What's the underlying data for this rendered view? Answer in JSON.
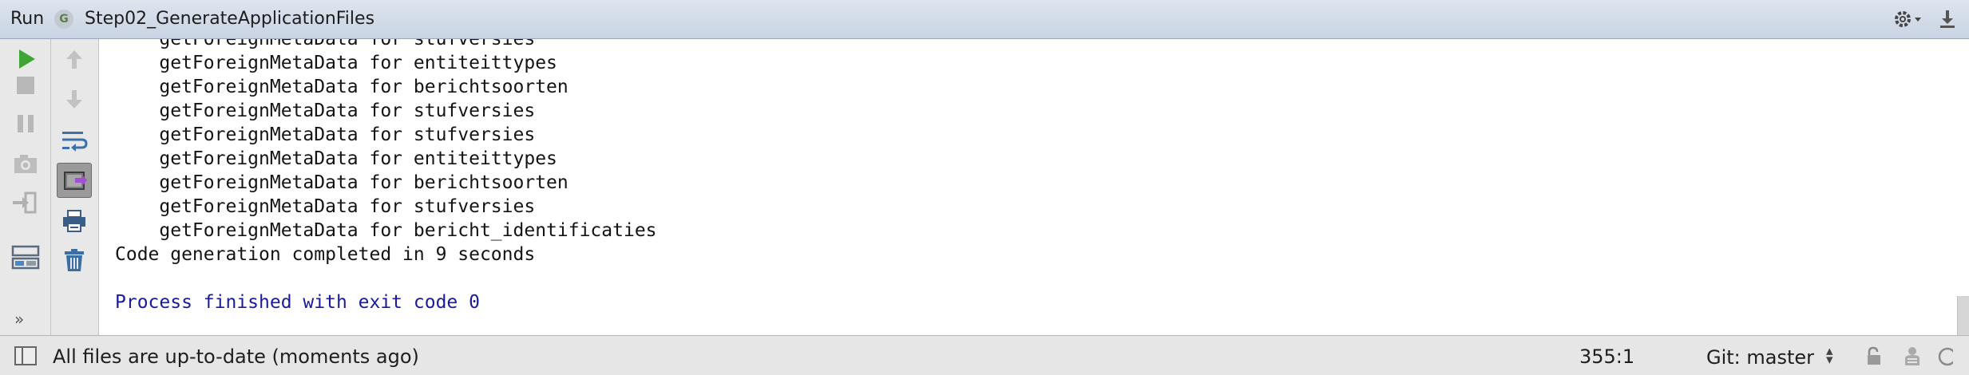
{
  "titlebar": {
    "run_label": "Run",
    "config_icon_letter": "G",
    "config_name": "Step02_GenerateApplicationFiles",
    "settings_icon": "gear-icon",
    "hide_icon": "pin-icon"
  },
  "toolbar_left": [
    {
      "name": "rerun-button",
      "icon": "play-icon",
      "color": "#3fa535"
    },
    {
      "name": "stop-button",
      "icon": "stop-icon"
    },
    {
      "name": "pause-button",
      "icon": "pause-icon"
    },
    {
      "name": "dump-threads-button",
      "icon": "camera-icon"
    },
    {
      "name": "exit-button",
      "icon": "exit-icon"
    },
    {
      "name": "restore-layout-button",
      "icon": "layout-icon"
    }
  ],
  "toolbar_second": [
    {
      "name": "prev-occurrence-button",
      "icon": "arrow-up-icon"
    },
    {
      "name": "next-occurrence-button",
      "icon": "arrow-down-icon"
    },
    {
      "name": "soft-wrap-button",
      "icon": "soft-wrap-icon"
    },
    {
      "name": "scroll-to-end-button",
      "icon": "scroll-to-end-icon",
      "pressed": true
    },
    {
      "name": "print-button",
      "icon": "print-icon"
    },
    {
      "name": "clear-all-button",
      "icon": "trash-icon"
    }
  ],
  "more_label": "»",
  "console": {
    "lines": [
      {
        "text": "    getForeignMetaData for stufversies",
        "kind": "normal"
      },
      {
        "text": "    getForeignMetaData for entiteittypes",
        "kind": "normal"
      },
      {
        "text": "    getForeignMetaData for berichtsoorten",
        "kind": "normal"
      },
      {
        "text": "    getForeignMetaData for stufversies",
        "kind": "normal"
      },
      {
        "text": "    getForeignMetaData for stufversies",
        "kind": "normal"
      },
      {
        "text": "    getForeignMetaData for entiteittypes",
        "kind": "normal"
      },
      {
        "text": "    getForeignMetaData for berichtsoorten",
        "kind": "normal"
      },
      {
        "text": "    getForeignMetaData for stufversies",
        "kind": "normal"
      },
      {
        "text": "    getForeignMetaData for bericht_identificaties",
        "kind": "normal"
      },
      {
        "text": "Code generation completed in 9 seconds",
        "kind": "normal"
      },
      {
        "text": "",
        "kind": "normal"
      },
      {
        "text": "Process finished with exit code 0",
        "kind": "system"
      }
    ]
  },
  "statusbar": {
    "message": "All files are up-to-date (moments ago)",
    "position": "355:1",
    "git_branch": "Git: master",
    "git_arrows": "⬍",
    "icons": [
      "lock-icon",
      "inspector-icon",
      "memory-icon"
    ]
  }
}
